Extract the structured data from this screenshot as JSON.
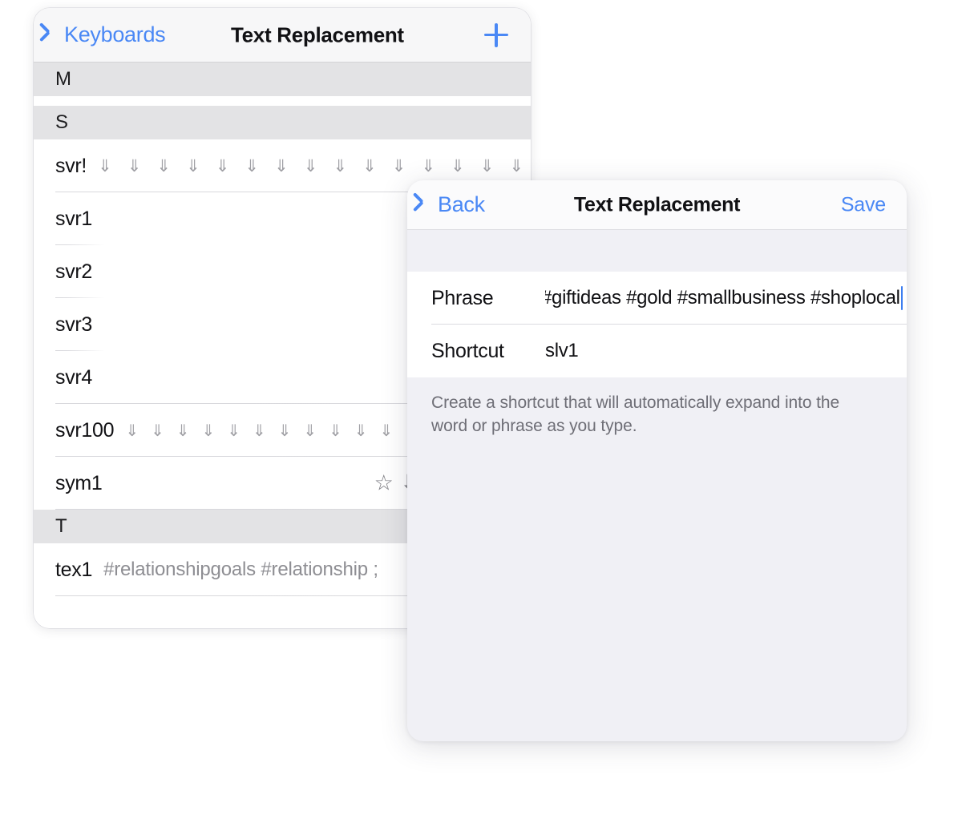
{
  "colors": {
    "accent_blue": "#4a88f5",
    "section_header_bg": "#e3e3e5",
    "sheet_bg": "#f0f0f5",
    "row_bg": "#ffffff",
    "secondary_text": "#8e8e93",
    "caret_blue": "#3d7ef0"
  },
  "list_panel": {
    "nav": {
      "back_label": "Keyboards",
      "title": "Text Replacement",
      "add_label": "+"
    },
    "sections": [
      {
        "letter": "M",
        "rows": []
      },
      {
        "letter": "S",
        "rows": [
          {
            "shortcut": "svr!",
            "phrase": "⇓ ⇓ ⇓ ⇓ ⇓ ⇓ ⇓ ⇓ ⇓ ⇓ ⇓ ⇓ ⇓ ⇓ ⇓ ⇓ ⇓ ⇓ ⇓ ⇓ ⇓ ⇓ ⇓ ⇓ ⇓ ⇓ ⇓…",
            "kind": "arrows"
          },
          {
            "shortcut": "svr1",
            "phrase": "",
            "kind": "plain"
          },
          {
            "shortcut": "svr2",
            "phrase": "",
            "kind": "plain"
          },
          {
            "shortcut": "svr3",
            "phrase": "",
            "kind": "plain"
          },
          {
            "shortcut": "svr4",
            "phrase": "",
            "kind": "plain"
          },
          {
            "shortcut": "svr100",
            "phrase": "⇓ ⇓ ⇓ ⇓ ⇓ ⇓ ⇓ ⇓ ⇓ ⇓ ⇓ ⇓ ⇓ ⇓ ⇓ ⇓ ⇓ ⇓ ⇓ ⇓ ⇓ ⇓",
            "kind": "arrows"
          },
          {
            "shortcut": "sym1",
            "phrase": "",
            "kind": "symbols",
            "symbols": "☆ ⇩"
          }
        ]
      },
      {
        "letter": "T",
        "rows": [
          {
            "shortcut": "tex1",
            "phrase": "#relationshipgoals #relationship ;",
            "kind": "plain-value"
          }
        ]
      }
    ]
  },
  "edit_panel": {
    "nav": {
      "back_label": "Back",
      "title": "Text Replacement",
      "save_label": "Save"
    },
    "fields": [
      {
        "label": "Phrase",
        "value": "#giftideas #gold #smallbusiness #shoplocal",
        "focused": true
      },
      {
        "label": "Shortcut",
        "value": "slv1",
        "focused": false
      }
    ],
    "footer_text": "Create a shortcut that will automatically expand into the word or phrase as you type."
  }
}
